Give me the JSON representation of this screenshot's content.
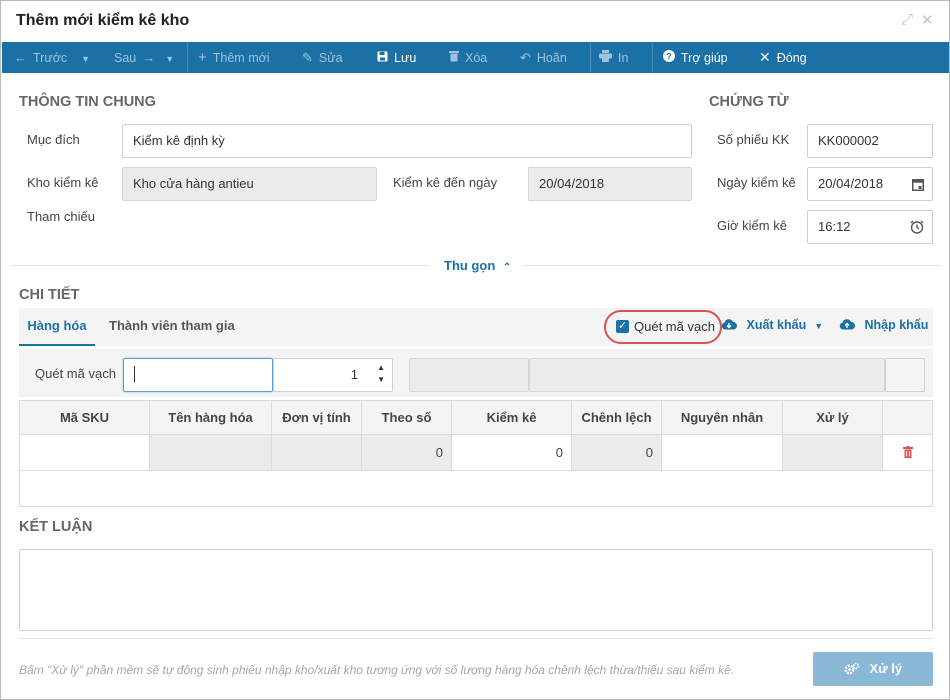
{
  "window": {
    "title": "Thêm mới kiểm kê kho"
  },
  "toolbar": {
    "prev": "Trước",
    "next": "Sau",
    "add": "Thêm mới",
    "edit": "Sửa",
    "save": "Lưu",
    "delete": "Xóa",
    "undo": "Hoãn",
    "print": "In",
    "help": "Trợ giúp",
    "close": "Đóng"
  },
  "general": {
    "heading": "THÔNG TIN CHUNG",
    "purpose_label": "Mục đích",
    "purpose_value": "Kiểm kê định kỳ",
    "warehouse_label": "Kho kiểm kê",
    "warehouse_value": "Kho cửa hàng antieu",
    "to_date_label": "Kiểm kê đến ngày",
    "to_date_value": "20/04/2018",
    "reference_label": "Tham chiếu"
  },
  "voucher": {
    "heading": "CHỨNG TỪ",
    "number_label": "Số phiếu KK",
    "number_value": "KK000002",
    "date_label": "Ngày kiểm kê",
    "date_value": "20/04/2018",
    "time_label": "Giờ kiểm kê",
    "time_value": "16:12"
  },
  "collapse_label": "Thu gọn",
  "detail": {
    "heading": "CHI TIẾT",
    "tabs": [
      "Hàng hóa",
      "Thành viên tham gia"
    ],
    "scan_checkbox_label": "Quét mã vạch",
    "scan_checked": true,
    "export_label": "Xuất khẩu",
    "import_label": "Nhập khẩu",
    "scan_label": "Quét mã vạch",
    "scan_value": "",
    "quantity_value": "1"
  },
  "grid": {
    "columns": [
      "Mã SKU",
      "Tên hàng hóa",
      "Đơn vị tính",
      "Theo số",
      "Kiểm kê",
      "Chênh lệch",
      "Nguyên nhân",
      "Xử lý"
    ],
    "rows": [
      {
        "sku": "",
        "name": "",
        "unit": "",
        "book": "0",
        "counted": "0",
        "diff": "0",
        "reason": "",
        "action": ""
      }
    ]
  },
  "conclusion": {
    "heading": "KẾT LUẬN",
    "value": ""
  },
  "footer": {
    "note": "Bấm \"Xử lý\" phần mềm sẽ tự động sinh phiếu nhập kho/xuất kho tương ứng với số lượng hàng hóa chênh lệch thừa/thiếu sau kiểm kê.",
    "process_label": "Xử lý"
  },
  "icons": {
    "expand": "expand-icon",
    "close": "close-icon",
    "calendar": "calendar-icon",
    "clock": "clock-icon",
    "trash": "trash-icon",
    "gears": "gears-icon"
  },
  "colors": {
    "toolbar": "#1b70a6",
    "accent": "#1b70a6",
    "danger": "#d9534f",
    "process_button": "#8ab9d8"
  }
}
